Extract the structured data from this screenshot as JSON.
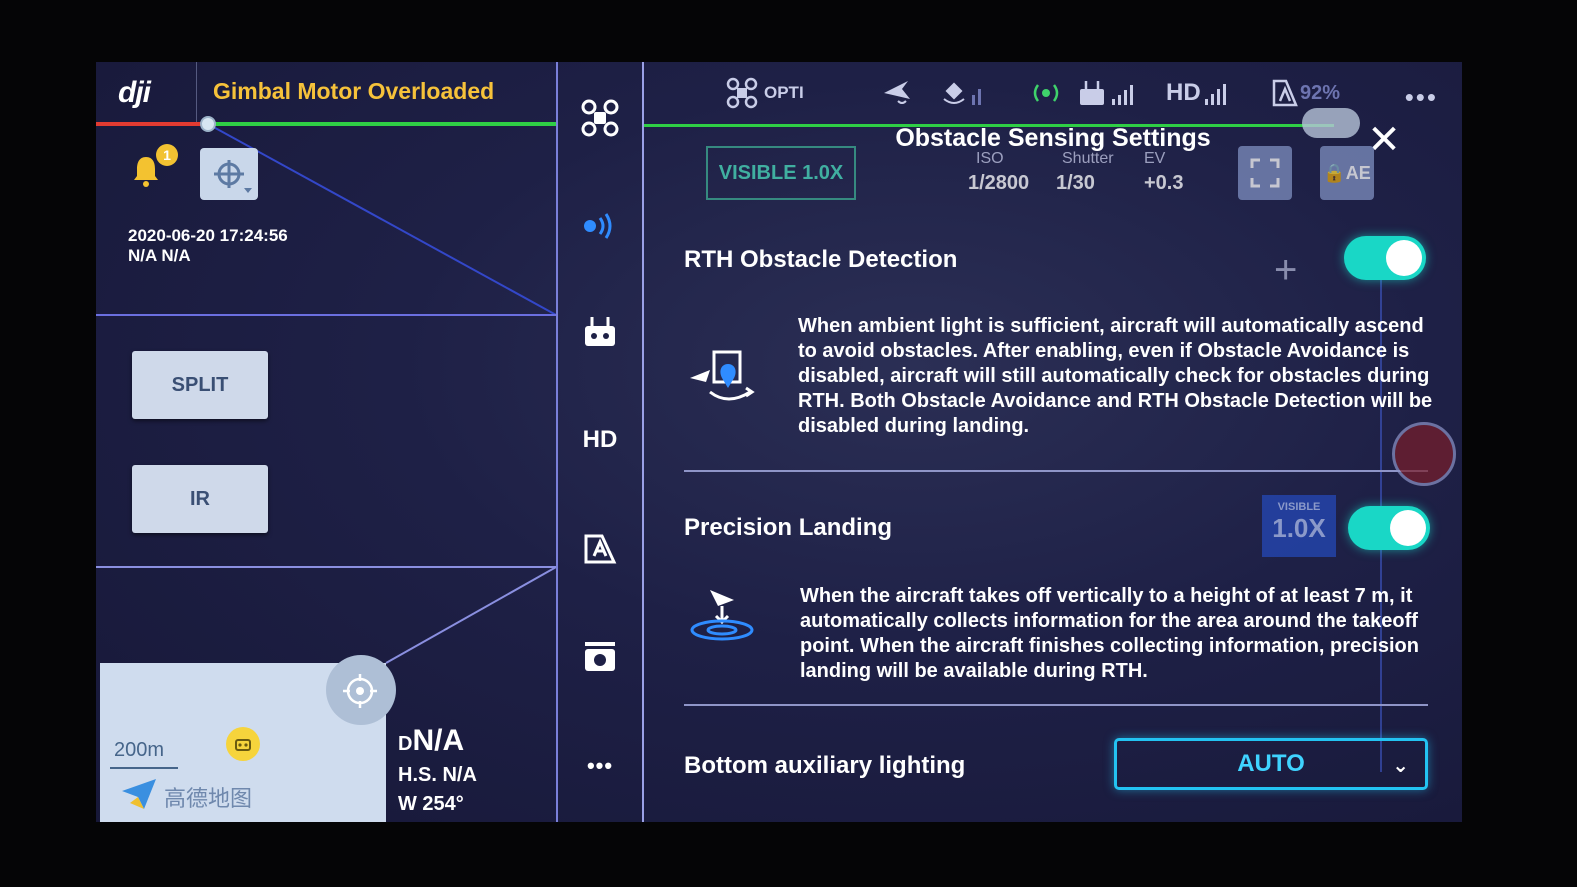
{
  "left": {
    "brand": "dji",
    "warning": "Gimbal Motor Overloaded",
    "notification_count": "1",
    "datetime": "2020-06-20 17:24:56",
    "coords": "N/A N/A",
    "split_label": "SPLIT",
    "ir_label": "IR",
    "map_scale": "200m",
    "map_brand": "高德地图",
    "telemetry": {
      "d_prefix": "D",
      "d_value": "N/A",
      "hs": "H.S. N/A",
      "heading": "W  254°"
    }
  },
  "toolbar": {
    "items": [
      {
        "icon": "aircraft-icon"
      },
      {
        "icon": "radar-icon"
      },
      {
        "icon": "remote-controller-icon"
      },
      {
        "icon": "hd-icon",
        "label": "HD"
      },
      {
        "icon": "battery-icon"
      },
      {
        "icon": "camera-icon"
      },
      {
        "icon": "more-icon",
        "label": "•••"
      }
    ]
  },
  "status": {
    "mode": "OPTI",
    "hd": "HD",
    "battery": "92%",
    "more": "•••"
  },
  "panel": {
    "title": "Obstacle Sensing Settings",
    "camera": {
      "lens": "VISIBLE 1.0X",
      "iso_label": "ISO",
      "iso_value": "1/2800",
      "shutter_label": "Shutter",
      "shutter_value": "1/30",
      "ev_label": "EV",
      "ev_value": "+0.3",
      "ae_label": "AE"
    },
    "rth": {
      "title": "RTH Obstacle Detection",
      "enabled": true,
      "description": "When ambient light is sufficient, aircraft will automatically ascend to avoid obstacles. After enabling, even if Obstacle Avoidance is disabled, aircraft will still automatically check for obstacles during RTH. Both Obstacle Avoidance and RTH Obstacle Detection will be disabled during landing."
    },
    "precision": {
      "title": "Precision Landing",
      "enabled": true,
      "zoom_small": "VISIBLE",
      "zoom_value": "1.0X",
      "description": "When the aircraft takes off vertically to a height of at least 7 m, it automatically collects information for the area around the takeoff point. When the aircraft finishes collecting information, precision landing will be available during RTH."
    },
    "lighting": {
      "title": "Bottom auxiliary lighting",
      "value": "AUTO"
    }
  }
}
